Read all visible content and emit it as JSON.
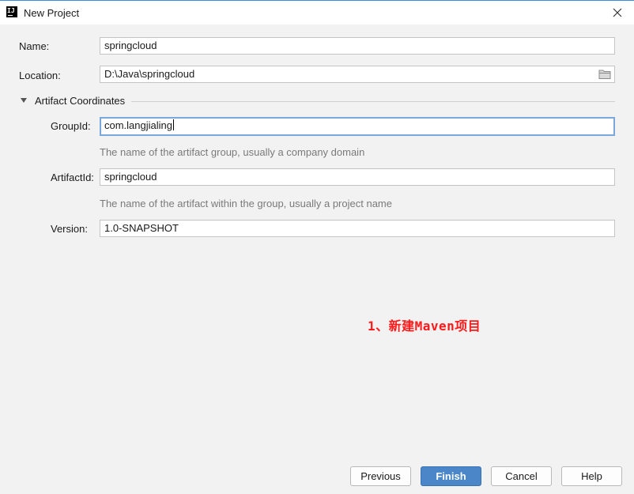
{
  "window": {
    "title": "New Project",
    "icon": "intellij-idea-icon"
  },
  "form": {
    "name": {
      "label": "Name:",
      "value": "springcloud"
    },
    "location": {
      "label": "Location:",
      "value": "D:\\Java\\springcloud",
      "icon": "folder-icon"
    },
    "artifact_section": {
      "label": "Artifact Coordinates",
      "group_id": {
        "label": "GroupId:",
        "value": "com.langjialing",
        "hint": "The name of the artifact group, usually a company domain"
      },
      "artifact_id": {
        "label": "ArtifactId:",
        "value": "springcloud",
        "hint": "The name of the artifact within the group, usually a project name"
      },
      "version": {
        "label": "Version:",
        "value": "1.0-SNAPSHOT"
      }
    }
  },
  "annotation": "1、新建Maven项目",
  "buttons": {
    "previous": "Previous",
    "finish": "Finish",
    "cancel": "Cancel",
    "help": "Help"
  },
  "colors": {
    "primary_button": "#4a86c8",
    "focus_border": "#7aa7dc",
    "annotation": "#ff1a1a",
    "title_accent": "#3c8dde"
  }
}
